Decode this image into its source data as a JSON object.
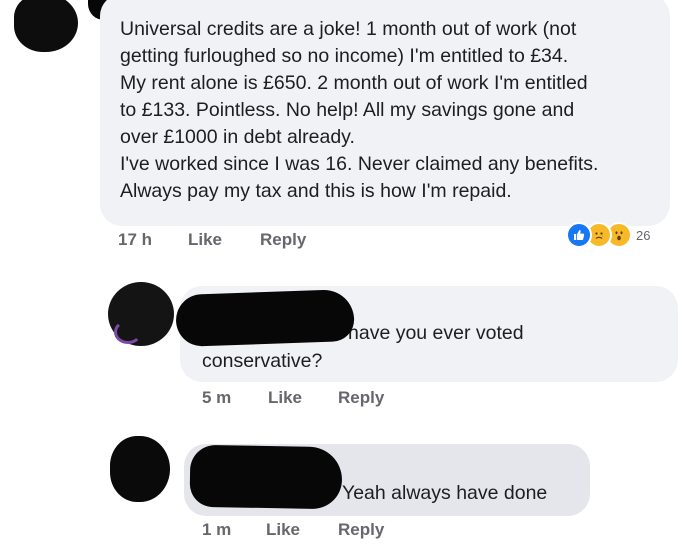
{
  "comments": [
    {
      "text": "Universal credits are a joke! 1 month out of work (not\ngetting furloughed so no income) I'm entitled to £34.\nMy rent alone is £650. 2 month out of work I'm entitled\nto £133. Pointless. No help! All my savings gone and\nover £1000 in debt already.\nI've worked since I was 16. Never claimed any benefits.\nAlways pay my tax and this is how I'm repaid.",
      "time": "17 h",
      "like": "Like",
      "reply": "Reply",
      "reaction_count": "26",
      "reactions": [
        "like-icon",
        "sad-icon",
        "wow-icon"
      ]
    },
    {
      "text_part1": "have you ever voted",
      "text_part2": "conservative?",
      "time": "5 m",
      "like": "Like",
      "reply": "Reply"
    },
    {
      "text": "Yeah always have done",
      "time": "1 m",
      "like": "Like",
      "reply": "Reply"
    }
  ],
  "colors": {
    "bubble": "#f0f2f5",
    "bubble_dark": "#e4e6eb",
    "meta_text": "#65676b",
    "like_blue": "#1877f2",
    "emoji_yellow": "#f7b928"
  }
}
